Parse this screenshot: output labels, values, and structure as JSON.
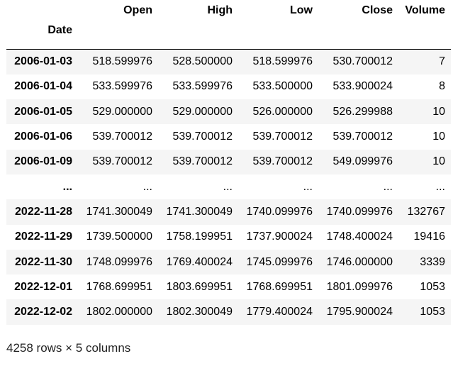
{
  "columns": [
    "Open",
    "High",
    "Low",
    "Close",
    "Volume"
  ],
  "index_name": "Date",
  "rows": [
    {
      "date": "2006-01-03",
      "values": [
        "518.599976",
        "528.500000",
        "518.599976",
        "530.700012",
        "7"
      ]
    },
    {
      "date": "2006-01-04",
      "values": [
        "533.599976",
        "533.599976",
        "533.500000",
        "533.900024",
        "8"
      ]
    },
    {
      "date": "2006-01-05",
      "values": [
        "529.000000",
        "529.000000",
        "526.000000",
        "526.299988",
        "10"
      ]
    },
    {
      "date": "2006-01-06",
      "values": [
        "539.700012",
        "539.700012",
        "539.700012",
        "539.700012",
        "10"
      ]
    },
    {
      "date": "2006-01-09",
      "values": [
        "539.700012",
        "539.700012",
        "539.700012",
        "549.099976",
        "10"
      ]
    },
    {
      "date": "...",
      "values": [
        "...",
        "...",
        "...",
        "...",
        "..."
      ]
    },
    {
      "date": "2022-11-28",
      "values": [
        "1741.300049",
        "1741.300049",
        "1740.099976",
        "1740.099976",
        "132767"
      ]
    },
    {
      "date": "2022-11-29",
      "values": [
        "1739.500000",
        "1758.199951",
        "1737.900024",
        "1748.400024",
        "19416"
      ]
    },
    {
      "date": "2022-11-30",
      "values": [
        "1748.099976",
        "1769.400024",
        "1745.099976",
        "1746.000000",
        "3339"
      ]
    },
    {
      "date": "2022-12-01",
      "values": [
        "1768.699951",
        "1803.699951",
        "1768.699951",
        "1801.099976",
        "1053"
      ]
    },
    {
      "date": "2022-12-02",
      "values": [
        "1802.000000",
        "1802.300049",
        "1779.400024",
        "1795.900024",
        "1053"
      ]
    }
  ],
  "footer": "4258 rows × 5 columns"
}
